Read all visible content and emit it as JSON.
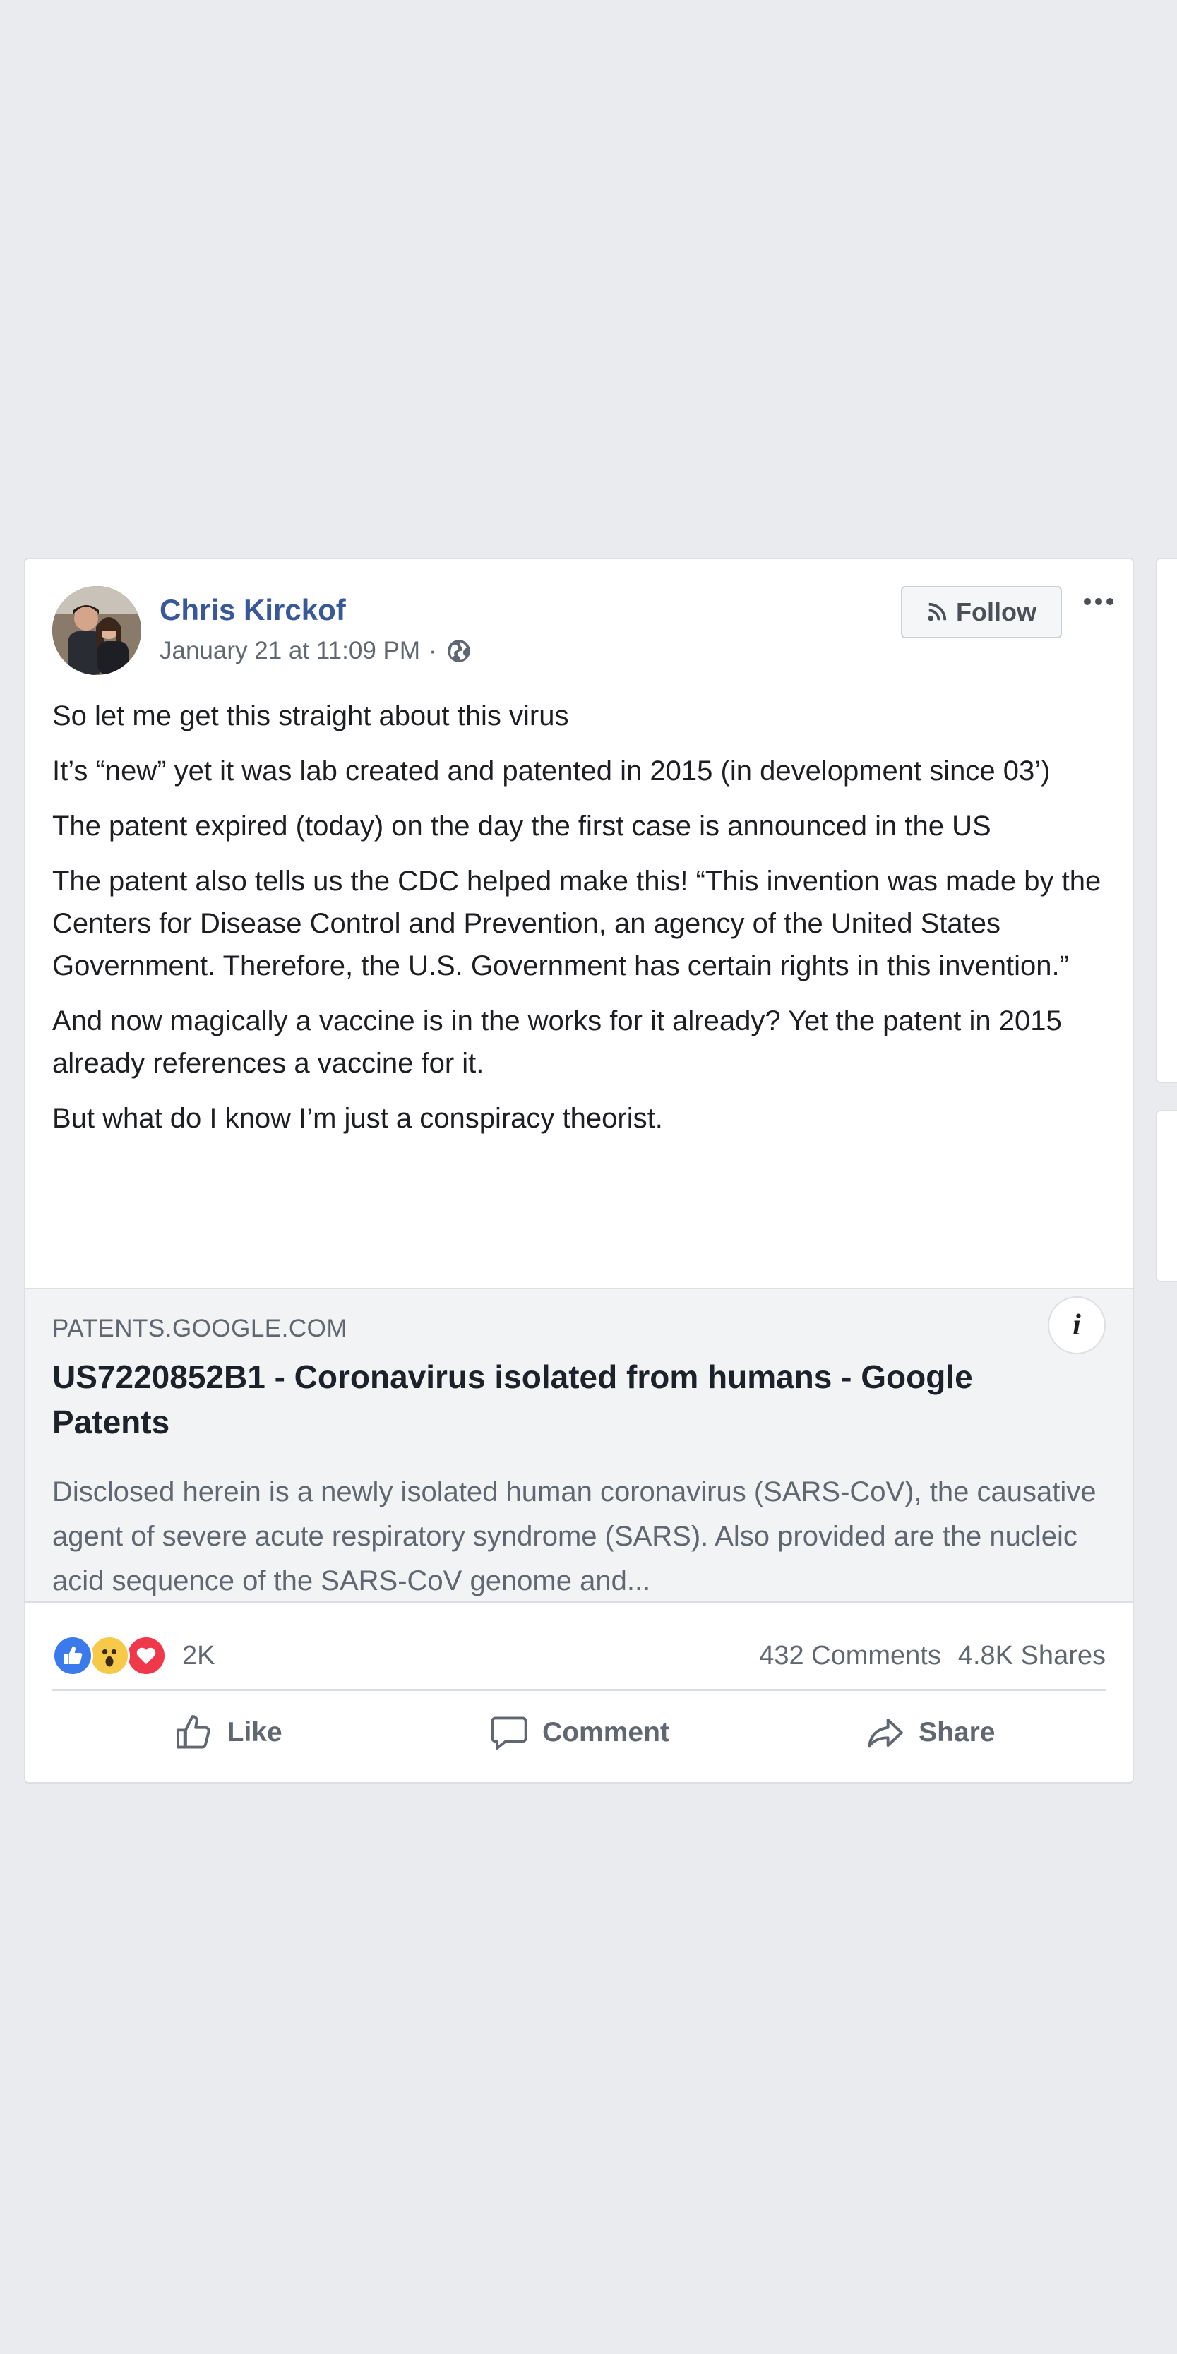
{
  "post": {
    "author": "Chris Kirckof",
    "timestamp": "January 21 at 11:09 PM",
    "separator": "·",
    "privacy_icon": "globe-icon",
    "follow_label": "Follow",
    "body": [
      "So let me get this straight about this virus",
      "It’s “new” yet it was lab created and patented in 2015 (in development since 03’)",
      "The patent expired (today) on the day the first case is announced in the US",
      "The patent also tells us the CDC helped make this! “This invention was made by the Centers for Disease Control and Prevention, an agency of the United States Government. Therefore, the U.S. Government has certain rights in this invention.”",
      "And now magically a vaccine is in the works for it already? Yet the patent in 2015 already references a vaccine for it.",
      "But what do I know I’m just a conspiracy theorist."
    ]
  },
  "link_preview": {
    "info_label": "i",
    "domain": "PATENTS.GOOGLE.COM",
    "title": "US7220852B1 - Coronavirus isolated from humans - Google Patents",
    "description": "Disclosed herein is a newly isolated human coronavirus (SARS-CoV), the causative agent of severe acute respiratory syndrome (SARS). Also provided are the nucleic acid sequence of the SARS-CoV genome and..."
  },
  "engagement": {
    "reaction_icons": [
      "like-reaction-icon",
      "wow-reaction-icon",
      "love-reaction-icon"
    ],
    "reaction_count": "2K",
    "comments": "432 Comments",
    "shares": "4.8K Shares"
  },
  "actions": {
    "like": "Like",
    "comment": "Comment",
    "share": "Share"
  },
  "colors": {
    "background": "#e9ebee",
    "author_link": "#385898",
    "secondary_text": "#606770",
    "like_blue": "#3b7aea",
    "love_red": "#f0384b",
    "wow_yellow": "#f7c948"
  }
}
